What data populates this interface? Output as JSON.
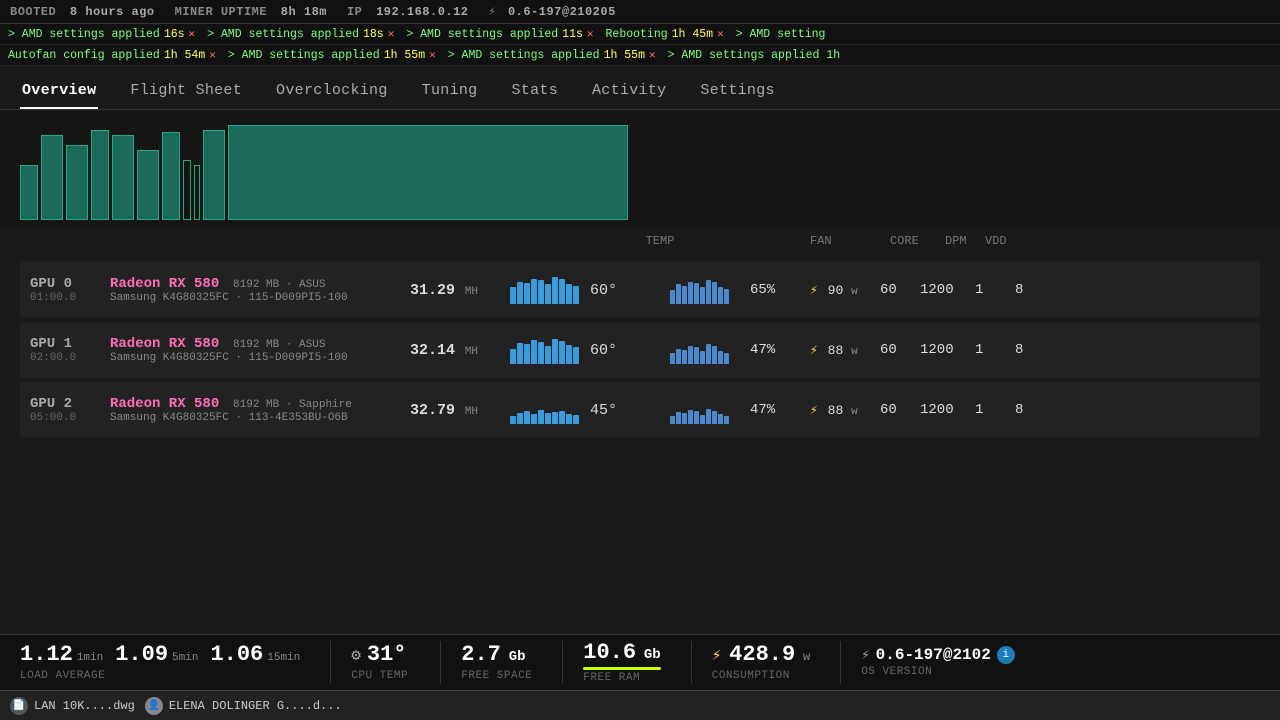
{
  "topbar": {
    "booted_label": "BOOTED",
    "booted_value": "8 hours ago",
    "uptime_label": "MINER UPTIME",
    "uptime_value": "8h 18m",
    "ip_label": "IP",
    "ip_value": "192.168.0.12",
    "os_version": "0.6-197@210205"
  },
  "notifications": [
    {
      "text": "> AMD settings applied",
      "time": "16s",
      "has_close": true
    },
    {
      "text": "> AMD settings applied",
      "time": "18s",
      "has_close": true
    },
    {
      "text": "> AMD settings applied",
      "time": "11s",
      "has_close": true
    },
    {
      "text": "Rebooting",
      "time": "1h 45m",
      "has_close": true
    },
    {
      "text": "> AMD setting",
      "time": "",
      "has_close": false
    }
  ],
  "notifications2": [
    {
      "text": "Autofan config applied",
      "time": "1h 54m",
      "has_close": true
    },
    {
      "text": "> AMD settings applied",
      "time": "1h 55m",
      "has_close": true
    },
    {
      "text": "> AMD settings applied",
      "time": "1h 55m",
      "has_close": true
    },
    {
      "text": "> AMD settings applied",
      "time": "1h",
      "has_close": false
    }
  ],
  "nav": {
    "tabs": [
      "Overview",
      "Flight Sheet",
      "Overclocking",
      "Tuning",
      "Stats",
      "Activity",
      "Settings"
    ],
    "active_tab": "Overview"
  },
  "gpu_table": {
    "headers": {
      "temp": "TEMP",
      "fan": "FAN",
      "core": "CORE",
      "dpm": "DPM",
      "vdd": "VDD"
    },
    "gpus": [
      {
        "id": "GPU 0",
        "time": "01:00.0",
        "model": "Radeon RX 580",
        "vram": "8192 MB",
        "brand": "ASUS",
        "mem1": "Samsung K4G80325FC",
        "mem2": "115-D009PI5-100",
        "hash": "31.29",
        "hash_unit": "MH",
        "temp": "60°",
        "fan_pct": "65%",
        "power": "90",
        "power_unit": "w",
        "fan": "60",
        "core": "1200",
        "dpm": "1",
        "vdd": "8",
        "bar_heights": [
          60,
          80,
          75,
          90,
          85,
          70,
          95,
          88,
          72,
          65
        ],
        "fan_bar_heights": [
          50,
          70,
          65,
          80,
          75,
          60,
          85,
          78,
          62,
          55
        ]
      },
      {
        "id": "GPU 1",
        "time": "02:00.0",
        "model": "Radeon RX 580",
        "vram": "8192 MB",
        "brand": "ASUS",
        "mem1": "Samsung K4G80325FC",
        "mem2": "115-D009PI5-100",
        "hash": "32.14",
        "hash_unit": "MH",
        "temp": "60°",
        "fan_pct": "47%",
        "power": "88",
        "power_unit": "w",
        "fan": "60",
        "core": "1200",
        "dpm": "1",
        "vdd": "8",
        "bar_heights": [
          55,
          75,
          70,
          85,
          80,
          65,
          90,
          83,
          67,
          60
        ],
        "fan_bar_heights": [
          40,
          55,
          50,
          65,
          60,
          45,
          70,
          63,
          47,
          40
        ]
      },
      {
        "id": "GPU 2",
        "time": "05:00.0",
        "model": "Radeon RX 580",
        "vram": "8192 MB",
        "brand": "Sapphire",
        "mem1": "Samsung K4G80325FC",
        "mem2": "113-4E353BU-O6B",
        "hash": "32.79",
        "hash_unit": "MH",
        "temp": "45°",
        "fan_pct": "47%",
        "power": "88",
        "power_unit": "w",
        "fan": "60",
        "core": "1200",
        "dpm": "1",
        "vdd": "8",
        "bar_heights": [
          30,
          40,
          45,
          35,
          50,
          38,
          42,
          48,
          36,
          32
        ],
        "fan_bar_heights": [
          30,
          42,
          38,
          50,
          45,
          32,
          55,
          48,
          35,
          30
        ]
      }
    ]
  },
  "bottom": {
    "load1": "1.12",
    "load1_label": "1min",
    "load5": "1.09",
    "load5_label": "5min",
    "load15": "1.06",
    "load15_label": "15min",
    "load_avg_label": "LOAD AVERAGE",
    "cpu_temp": "31°",
    "cpu_temp_label": "CPU TEMP",
    "free_space": "2.7",
    "free_space_unit": "Gb",
    "free_space_label": "FREE SPACE",
    "free_ram": "10.6",
    "free_ram_unit": "Gb",
    "free_ram_label": "FREE RAM",
    "consumption": "428.9",
    "consumption_unit": "w",
    "consumption_label": "CONSUMPTION",
    "os_version": "0.6-197@2102",
    "os_version_label": "OS VERSION"
  },
  "taskbar": {
    "file1": "LAN 10K....dwg",
    "file2": "ELENA DOLINGER G....d..."
  }
}
